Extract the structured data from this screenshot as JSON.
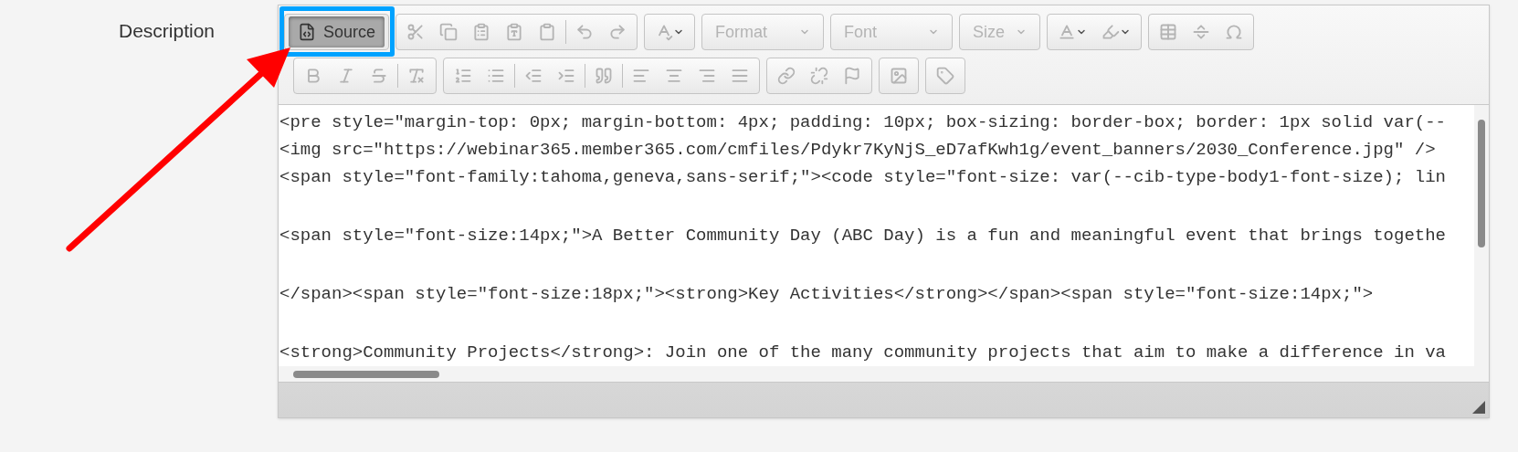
{
  "field": {
    "label": "Description"
  },
  "toolbar": {
    "source_button": {
      "label": "Source",
      "selected": true
    },
    "icons_disabled": true,
    "dropdowns": [
      {
        "label": "Format",
        "disabled": true
      },
      {
        "label": "Font",
        "disabled": true
      },
      {
        "label": "Size",
        "disabled": true
      }
    ]
  },
  "editor": {
    "blocks": [
      {
        "lines": [
          "<pre style=\"margin-top: 0px; margin-bottom: 4px; padding: 10px; box-sizing: border-box; border: 1px solid var(--",
          "<img src=\"https://webinar365.member365.com/cmfiles/Pdykr7KyNjS_eD7afKwh1g/event_banners/2030_Conference.jpg\" />",
          "<span style=\"font-family:tahoma,geneva,sans-serif;\"><code style=\"font-size: var(--cib-type-body1-font-size); lin"
        ]
      },
      {
        "lines": [
          "<span style=\"font-size:14px;\">A Better Community Day (ABC Day) is a fun and meaningful event that brings togethe"
        ]
      },
      {
        "lines": [
          "</span><span style=\"font-size:18px;\"><strong>Key Activities</strong></span><span style=\"font-size:14px;\">"
        ]
      },
      {
        "lines": [
          "<strong>Community Projects</strong>: Join one of the many community projects that aim to make a difference in va"
        ]
      }
    ]
  },
  "annotations": [
    {
      "kind": "frame"
    },
    {
      "kind": "arrow"
    }
  ]
}
